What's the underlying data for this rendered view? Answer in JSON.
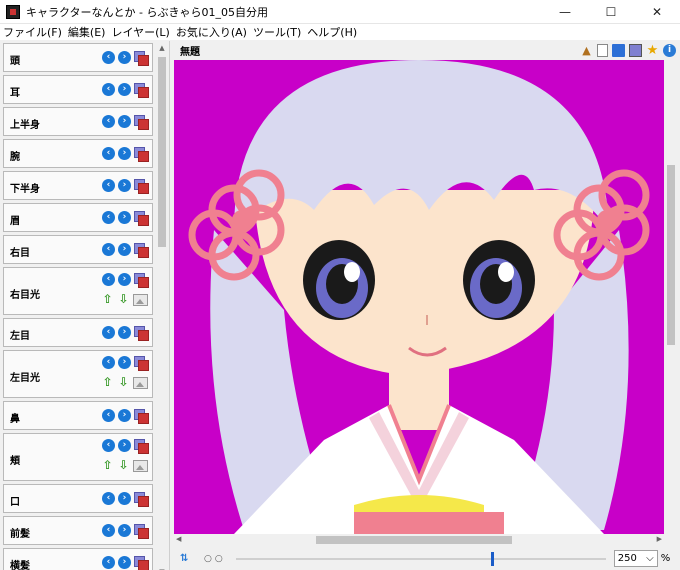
{
  "window": {
    "title": "キャラクターなんとか - らぶきゃら01_05自分用",
    "minimize": "—",
    "maximize": "☐",
    "close": "✕"
  },
  "menu": [
    {
      "label": "ファイル(F)"
    },
    {
      "label": "編集(E)"
    },
    {
      "label": "レイヤー(L)"
    },
    {
      "label": "お気に入り(A)"
    },
    {
      "label": "ツール(T)"
    },
    {
      "label": "ヘルプ(H)"
    }
  ],
  "layers": [
    {
      "name": "頭",
      "type": "single"
    },
    {
      "name": "耳",
      "type": "single"
    },
    {
      "name": "上半身",
      "type": "single"
    },
    {
      "name": "腕",
      "type": "single"
    },
    {
      "name": "下半身",
      "type": "single"
    },
    {
      "name": "眉",
      "type": "single"
    },
    {
      "name": "右目",
      "type": "single"
    },
    {
      "name": "右目光",
      "type": "double"
    },
    {
      "name": "左目",
      "type": "single"
    },
    {
      "name": "左目光",
      "type": "double"
    },
    {
      "name": "鼻",
      "type": "single"
    },
    {
      "name": "頬",
      "type": "double"
    },
    {
      "name": "口",
      "type": "single"
    },
    {
      "name": "前髪",
      "type": "single"
    },
    {
      "name": "横髪",
      "type": "single"
    }
  ],
  "canvas": {
    "title": "無題",
    "background_color": "#c800c8"
  },
  "status": {
    "zoom_value": "250",
    "zoom_unit": "%",
    "zoom_level": 0.69
  },
  "colors": {
    "accent": "#1a78d6",
    "canvas_bg": "#c800c8",
    "hair": "#d9d9f0",
    "skin": "#fce4cc",
    "flower": "#f08090",
    "obi": "#f5e84a"
  }
}
